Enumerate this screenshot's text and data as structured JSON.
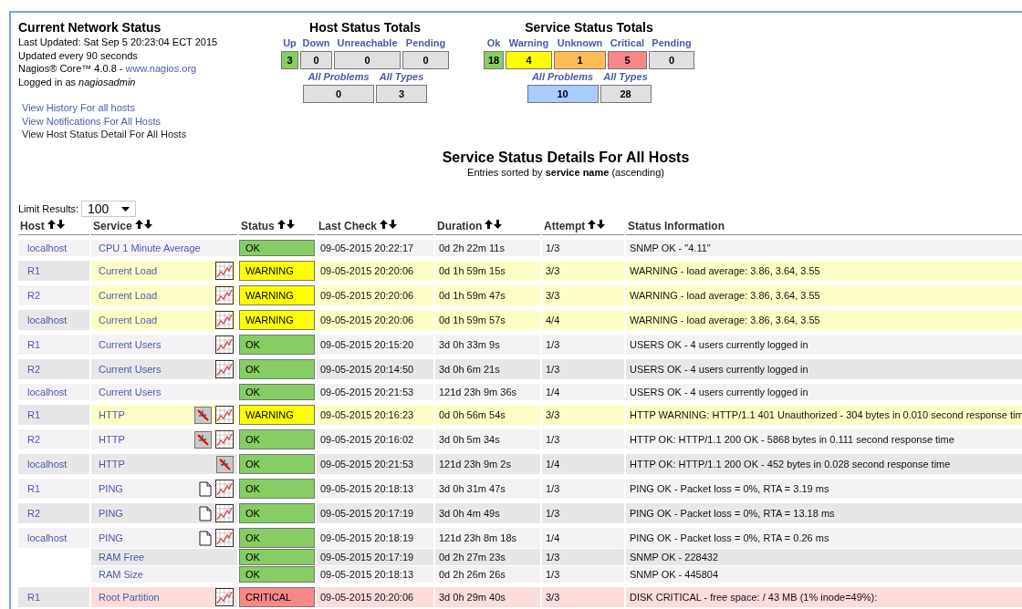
{
  "network_status": {
    "title": "Current Network Status",
    "lines": [
      "Last Updated: Sat Sep 5 20:23:04 ECT 2015",
      "Updated every 90 seconds"
    ],
    "version_text": "Nagios® Core™ 4.0.8 - ",
    "version_link": "www.nagios.org",
    "login_text": "Logged in as ",
    "login_user": "nagiosadmin",
    "links": [
      {
        "label": "View History For all hosts",
        "visited": false
      },
      {
        "label": "View Notifications For All Hosts",
        "visited": false
      },
      {
        "label": "View Host Status Detail For All Hosts",
        "visited": true
      }
    ]
  },
  "host_totals": {
    "title": "Host Status Totals",
    "items": [
      {
        "label": "Up",
        "count": "3",
        "color": "#86cd63"
      },
      {
        "label": "Down",
        "count": "0",
        "color": "#e0e0e0"
      },
      {
        "label": "Unreachable",
        "count": "0",
        "color": "#e0e0e0"
      },
      {
        "label": "Pending",
        "count": "0",
        "color": "#e0e0e0"
      }
    ],
    "summary": [
      {
        "label": "All Problems",
        "count": "0",
        "color": "#e0e0e0"
      },
      {
        "label": "All Types",
        "count": "3",
        "color": "#e0e0e0"
      }
    ]
  },
  "service_totals": {
    "title": "Service Status Totals",
    "items": [
      {
        "label": "Ok",
        "count": "18",
        "color": "#86cd63"
      },
      {
        "label": "Warning",
        "count": "4",
        "color": "#ffff00"
      },
      {
        "label": "Unknown",
        "count": "1",
        "color": "#ffbb55"
      },
      {
        "label": "Critical",
        "count": "5",
        "color": "#f88888"
      },
      {
        "label": "Pending",
        "count": "0",
        "color": "#e0e0e0"
      }
    ],
    "summary": [
      {
        "label": "All Problems",
        "count": "10",
        "color": "#aaccff"
      },
      {
        "label": "All Types",
        "count": "28",
        "color": "#e0e0e0"
      }
    ]
  },
  "details": {
    "title": "Service Status Details For All Hosts",
    "subtitle_before": "Entries sorted by ",
    "subtitle_key": "service name",
    "subtitle_after": " (ascending)"
  },
  "limit": {
    "label": "Limit Results:",
    "value": "100"
  },
  "table": {
    "columns": [
      "Host",
      "Service",
      "Status",
      "Last Check",
      "Duration",
      "Attempt",
      "Status Information"
    ],
    "sortable": [
      true,
      true,
      true,
      true,
      true,
      true,
      false
    ],
    "rows": [
      {
        "host": "localhost",
        "service": "CPU 1 Minute Average",
        "status": "OK",
        "last_check": "09-05-2015 20:22:17",
        "duration": "0d 2h 22m 11s",
        "attempt": "1/3",
        "info": "SNMP OK - \"4.11\"",
        "notes": false,
        "notifications_disabled": false,
        "graph": false
      },
      {
        "host": "R1",
        "service": "Current Load",
        "status": "WARNING",
        "last_check": "09-05-2015 20:20:06",
        "duration": "0d 1h 59m 15s",
        "attempt": "3/3",
        "info": "WARNING - load average: 3.86, 3.64, 3.55",
        "notes": false,
        "notifications_disabled": false,
        "graph": true
      },
      {
        "host": "R2",
        "service": "Current Load",
        "status": "WARNING",
        "last_check": "09-05-2015 20:20:06",
        "duration": "0d 1h 59m 47s",
        "attempt": "3/3",
        "info": "WARNING - load average: 3.86, 3.64, 3.55",
        "notes": false,
        "notifications_disabled": false,
        "graph": true
      },
      {
        "host": "localhost",
        "service": "Current Load",
        "status": "WARNING",
        "last_check": "09-05-2015 20:20:06",
        "duration": "0d 1h 59m 57s",
        "attempt": "4/4",
        "info": "WARNING - load average: 3.86, 3.64, 3.55",
        "notes": false,
        "notifications_disabled": false,
        "graph": true
      },
      {
        "host": "R1",
        "service": "Current Users",
        "status": "OK",
        "last_check": "09-05-2015 20:15:20",
        "duration": "3d 0h 33m 9s",
        "attempt": "1/3",
        "info": "USERS OK - 4 users currently logged in",
        "notes": false,
        "notifications_disabled": false,
        "graph": true
      },
      {
        "host": "R2",
        "service": "Current Users",
        "status": "OK",
        "last_check": "09-05-2015 20:14:50",
        "duration": "3d 0h 6m 21s",
        "attempt": "1/3",
        "info": "USERS OK - 4 users currently logged in",
        "notes": false,
        "notifications_disabled": false,
        "graph": true
      },
      {
        "host": "localhost",
        "service": "Current Users",
        "status": "OK",
        "last_check": "09-05-2015 20:21:53",
        "duration": "121d 23h 9m 36s",
        "attempt": "1/4",
        "info": "USERS OK - 4 users currently logged in",
        "notes": false,
        "notifications_disabled": false,
        "graph": false
      },
      {
        "host": "R1",
        "service": "HTTP",
        "status": "WARNING",
        "last_check": "09-05-2015 20:16:23",
        "duration": "0d 0h 56m 54s",
        "attempt": "3/3",
        "info": "HTTP WARNING: HTTP/1.1 401 Unauthorized - 304 bytes in 0.010 second response tim",
        "notes": false,
        "notifications_disabled": true,
        "graph": true
      },
      {
        "host": "R2",
        "service": "HTTP",
        "status": "OK",
        "last_check": "09-05-2015 20:16:02",
        "duration": "3d 0h 5m 34s",
        "attempt": "1/3",
        "info": "HTTP OK: HTTP/1.1 200 OK - 5868 bytes in 0.111 second response time",
        "notes": false,
        "notifications_disabled": true,
        "graph": true
      },
      {
        "host": "localhost",
        "service": "HTTP",
        "status": "OK",
        "last_check": "09-05-2015 20:21:53",
        "duration": "121d 23h 9m 2s",
        "attempt": "1/4",
        "info": "HTTP OK: HTTP/1.1 200 OK - 452 bytes in 0.028 second response time",
        "notes": false,
        "notifications_disabled": true,
        "graph": false
      },
      {
        "host": "R1",
        "service": "PING",
        "status": "OK",
        "last_check": "09-05-2015 20:18:13",
        "duration": "3d 0h 31m 47s",
        "attempt": "1/3",
        "info": "PING OK - Packet loss = 0%, RTA = 3.19 ms",
        "notes": true,
        "notifications_disabled": false,
        "graph": true
      },
      {
        "host": "R2",
        "service": "PING",
        "status": "OK",
        "last_check": "09-05-2015 20:17:19",
        "duration": "3d 0h 4m 49s",
        "attempt": "1/3",
        "info": "PING OK - Packet loss = 0%, RTA = 13.18 ms",
        "notes": true,
        "notifications_disabled": false,
        "graph": true
      },
      {
        "host": "localhost",
        "service": "PING",
        "status": "OK",
        "last_check": "09-05-2015 20:18:19",
        "duration": "121d 23h 8m 18s",
        "attempt": "1/4",
        "info": "PING OK - Packet loss = 0%, RTA = 0.26 ms",
        "notes": true,
        "notifications_disabled": false,
        "graph": true
      },
      {
        "service": "RAM Free",
        "status": "OK",
        "last_check": "09-05-2015 20:17:19",
        "duration": "0d 2h 27m 23s",
        "attempt": "1/3",
        "info": "SNMP OK - 228432",
        "notes": false,
        "notifications_disabled": false,
        "graph": false
      },
      {
        "service": "RAM Size",
        "status": "OK",
        "last_check": "09-05-2015 20:18:13",
        "duration": "0d 2h 26m 26s",
        "attempt": "1/3",
        "info": "SNMP OK - 445804",
        "notes": false,
        "notifications_disabled": false,
        "graph": false
      },
      {
        "host": "R1",
        "service": "Root Partition",
        "status": "CRITICAL",
        "last_check": "09-05-2015 20:20:06",
        "duration": "3d 0h 29m 40s",
        "attempt": "3/3",
        "info": "DISK CRITICAL - free space: / 43 MB (1% inode=49%):",
        "notes": false,
        "notifications_disabled": false,
        "graph": true
      }
    ]
  }
}
